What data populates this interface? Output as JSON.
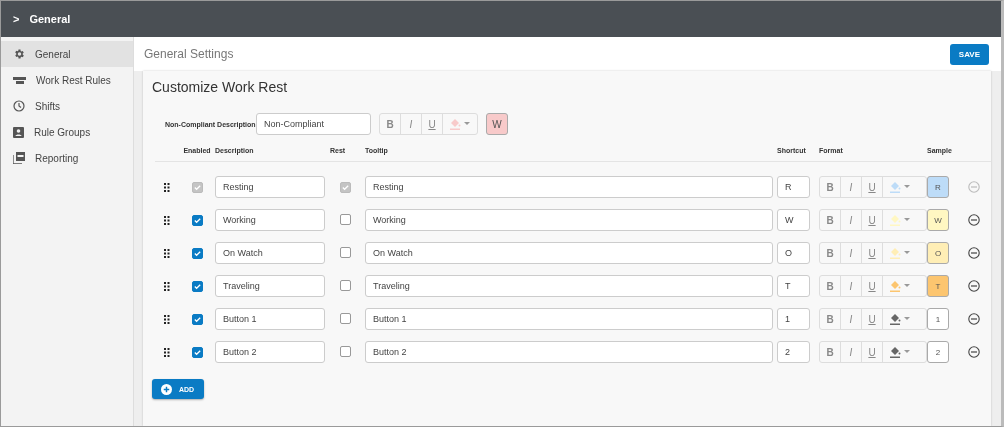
{
  "top_bar": {
    "chevron": ">",
    "title": "General"
  },
  "sidebar": {
    "items": [
      {
        "label": "General",
        "kind": "gear",
        "selected": true
      },
      {
        "label": "Work Rest Rules",
        "kind": "rules",
        "selected": false
      },
      {
        "label": "Shifts",
        "kind": "clock",
        "selected": false
      },
      {
        "label": "Rule Groups",
        "kind": "badge",
        "selected": false
      },
      {
        "label": "Reporting",
        "kind": "report",
        "selected": false
      }
    ]
  },
  "header": {
    "title": "General Settings",
    "save_button": "SAVE"
  },
  "card": {
    "title": "Customize Work Rest",
    "non_compliant": {
      "label": "Non-Compliant Description",
      "value": "Non-Compliant",
      "format": [
        "B",
        "I",
        "U"
      ],
      "sample": "W",
      "color": "#f8caca"
    },
    "columns": [
      "Enabled",
      "Description",
      "Rest",
      "Tooltip",
      "Shortcut",
      "Format",
      "Sample"
    ],
    "rows": [
      {
        "enabled": true,
        "description": "Resting",
        "rest": true,
        "tooltip": "Resting",
        "shortcut": "R",
        "format": [
          "B",
          "I",
          "U"
        ],
        "sample": "R",
        "color": "#bddcf8",
        "disabled": true
      },
      {
        "enabled": true,
        "description": "Working",
        "rest": false,
        "tooltip": "Working",
        "shortcut": "W",
        "format": [
          "B",
          "I",
          "U"
        ],
        "sample": "W",
        "color": "#fff7c2",
        "disabled": false
      },
      {
        "enabled": true,
        "description": "On Watch",
        "rest": false,
        "tooltip": "On Watch",
        "shortcut": "O",
        "format": [
          "B",
          "I",
          "U"
        ],
        "sample": "O",
        "color": "#ffeeb5",
        "disabled": false
      },
      {
        "enabled": true,
        "description": "Traveling",
        "rest": false,
        "tooltip": "Traveling",
        "shortcut": "T",
        "format": [
          "B",
          "I",
          "U"
        ],
        "sample": "T",
        "color": "#fcc56f",
        "disabled": false
      },
      {
        "enabled": true,
        "description": "Button 1",
        "rest": false,
        "tooltip": "Button 1",
        "shortcut": "1",
        "format": [
          "B",
          "I",
          "U"
        ],
        "sample": "1",
        "color": "#ffffff",
        "disabled": false
      },
      {
        "enabled": true,
        "description": "Button 2",
        "rest": false,
        "tooltip": "Button 2",
        "shortcut": "2",
        "format": [
          "B",
          "I",
          "U"
        ],
        "sample": "2",
        "color": "#ffffff",
        "disabled": false
      }
    ],
    "add_button": "ADD"
  }
}
